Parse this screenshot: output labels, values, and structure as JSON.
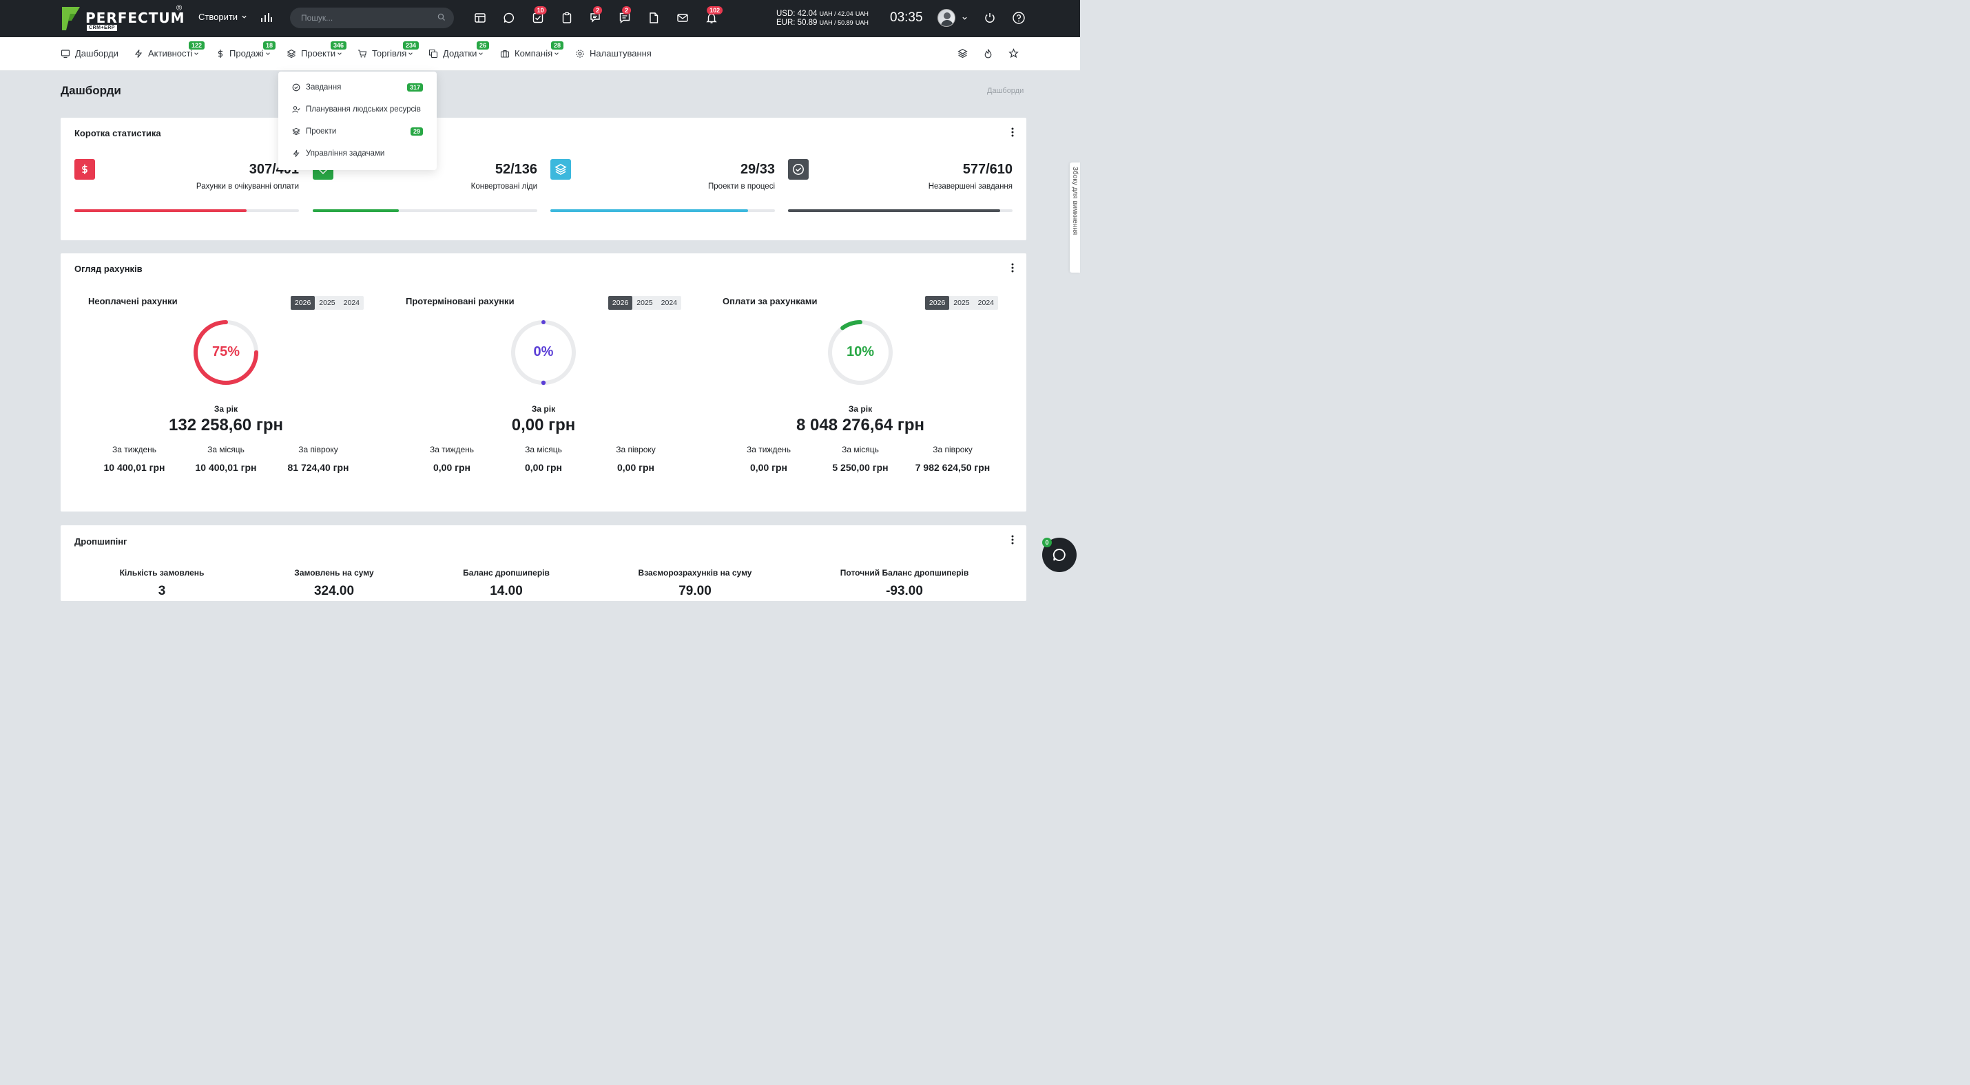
{
  "brand": {
    "name": "PERFECTUM",
    "reg": "®",
    "sub": "CRM+ERP"
  },
  "topbar": {
    "create_label": "Створити",
    "search_placeholder": "Пошук...",
    "badges": {
      "tasks": "10",
      "chat": "2",
      "messages": "2",
      "notifications": "102"
    },
    "currency_usd": "USD: 42.04",
    "currency_usd_unit": "UAH / 42.04",
    "currency_usd_unit2": "UAH",
    "currency_eur": "EUR: 50.89",
    "currency_eur_unit": "UAH / 50.89",
    "currency_eur_unit2": "UAH",
    "clock": "03:35"
  },
  "menu": {
    "dashboards": "Дашборди",
    "activities": "Активності",
    "activities_badge": "122",
    "sales": "Продажі",
    "sales_badge": "18",
    "projects": "Проекти",
    "projects_badge": "346",
    "trade": "Торгівля",
    "trade_badge": "234",
    "addons": "Додатки",
    "addons_badge": "26",
    "company": "Компанія",
    "company_badge": "28",
    "settings": "Налаштування"
  },
  "dropdown": {
    "items": [
      {
        "label": "Завдання",
        "badge": "317"
      },
      {
        "label": "Планування людських ресурсів",
        "badge": ""
      },
      {
        "label": "Проекти",
        "badge": "29"
      },
      {
        "label": "Управління задачами",
        "badge": ""
      }
    ]
  },
  "page": {
    "title": "Дашборди",
    "breadcrumb": "Дашборди"
  },
  "stats": {
    "title": "Коротка статистика",
    "items": [
      {
        "value": "307/401",
        "label": "Рахунки в очікуванні оплати",
        "progress": 0.766,
        "color": "#e8394f"
      },
      {
        "value": "52/136",
        "label": "Конвертовані ліди",
        "progress": 0.382,
        "color": "#28a745"
      },
      {
        "value": "29/33",
        "label": "Проекти в процесі",
        "progress": 0.879,
        "color": "#3cb8dd"
      },
      {
        "value": "577/610",
        "label": "Незавершені завдання",
        "progress": 0.946,
        "color": "#4a4f55"
      }
    ]
  },
  "invoices": {
    "title": "Огляд рахунків",
    "years": [
      "2026",
      "2025",
      "2024"
    ],
    "items": [
      {
        "title": "Неоплачені рахунки",
        "percent": "75%",
        "fraction": 0.75,
        "color": "#e8394f",
        "year_label": "За рік",
        "year_value": "132 258,60 грн",
        "week_label": "За тиждень",
        "week_value": "10 400,01 грн",
        "month_label": "За місяць",
        "month_value": "10 400,01 грн",
        "half_label": "За півроку",
        "half_value": "81 724,40 грн"
      },
      {
        "title": "Протерміновані рахунки",
        "percent": "0%",
        "fraction": 0,
        "color": "#5b3fd6",
        "year_label": "За рік",
        "year_value": "0,00 грн",
        "week_label": "За тиждень",
        "week_value": "0,00 грн",
        "month_label": "За місяць",
        "month_value": "0,00 грн",
        "half_label": "За півроку",
        "half_value": "0,00 грн"
      },
      {
        "title": "Оплати за рахунками",
        "percent": "10%",
        "fraction": 0.1,
        "color": "#28a745",
        "year_label": "За рік",
        "year_value": "8 048 276,64 грн",
        "week_label": "За тиждень",
        "week_value": "0,00 грн",
        "month_label": "За місяць",
        "month_value": "5 250,00 грн",
        "half_label": "За півроку",
        "half_value": "7 982 624,50 грн"
      }
    ]
  },
  "dropshipping": {
    "title": "Дропшипінг",
    "items": [
      {
        "label": "Кількість замовлень",
        "value": "3"
      },
      {
        "label": "Замовлень на суму",
        "value": "324.00"
      },
      {
        "label": "Баланс дропшиперів",
        "value": "14.00"
      },
      {
        "label": "Взаєморозрахунків на суму",
        "value": "79.00"
      },
      {
        "label": "Поточний Баланс дропшиперів",
        "value": "-93.00"
      }
    ]
  },
  "side_tab": "Збоку для вимкнення",
  "chat_badge": "0"
}
